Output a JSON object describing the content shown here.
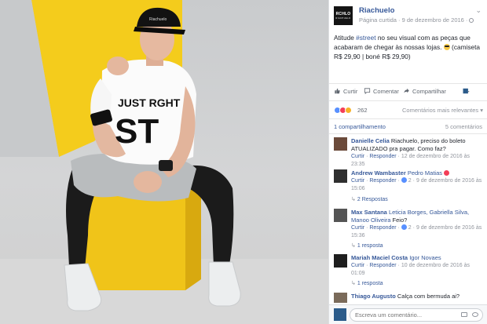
{
  "photo": {
    "shirt_text_top": "JUST RGHT",
    "shirt_text_big": "ST",
    "cap_text": "Riachuelo"
  },
  "header": {
    "logo_text": "RCHLO",
    "logo_sub": "RIACHUELO",
    "page_name": "Riachuelo",
    "meta": "Página curtida · 9 de dezembro de 2016 ·",
    "more": "⌄"
  },
  "post": {
    "text_a": "Atitude ",
    "hashtag": "#street",
    "text_b": " no seu visual com as peças que acabaram de chegar às nossas lojas. ",
    "text_c": " (camiseta R$ 29,90 | boné R$ 29,90)"
  },
  "actions": {
    "like": "Curtir",
    "comment": "Comentar",
    "share": "Compartilhar"
  },
  "reactions": {
    "count": "262",
    "sort": "Comentários mais relevantes ▾"
  },
  "stats": {
    "shares": "1 compartilhamento",
    "comments": "5 comentários"
  },
  "comments": [
    {
      "author": "Danielle Celia",
      "text": " Riachuelo, preciso do boleto ATUALIZADO pra pagar. Como faz?",
      "like": "Curtir",
      "reply": "Responder",
      "date": "12 de dezembro de 2016 às 23:35"
    },
    {
      "author": "Andrew Wambaster",
      "mention": " Pedro Matias",
      "like": "Curtir",
      "reply": "Responder",
      "reacts": "2",
      "date": "9 de dezembro de 2016 às 15:06",
      "replies": "2 Respostas"
    },
    {
      "author": "Max Santana",
      "mention": " Leticia Borges, Gabriella Silva, Manoo Oliveira",
      "text": " Feio?",
      "like": "Curtir",
      "reply": "Responder",
      "reacts": "2",
      "date": "9 de dezembro de 2016 às 15:36",
      "replies": "1 resposta"
    },
    {
      "author": "Mariah Maciel Costa",
      "mention": " Igor Novaes",
      "like": "Curtir",
      "reply": "Responder",
      "date": "10 de dezembro de 2016 às 01:09",
      "replies": "1 resposta"
    },
    {
      "author": "Thiago Augusto",
      "text": " Calça com bermuda ai?"
    }
  ],
  "composer": {
    "placeholder": "Escreva um comentário..."
  },
  "colors": {
    "brand_link": "#365899",
    "like_blue": "#5890ff",
    "love_red": "#f33e58",
    "photo_yellow": "#f4cc1c"
  }
}
